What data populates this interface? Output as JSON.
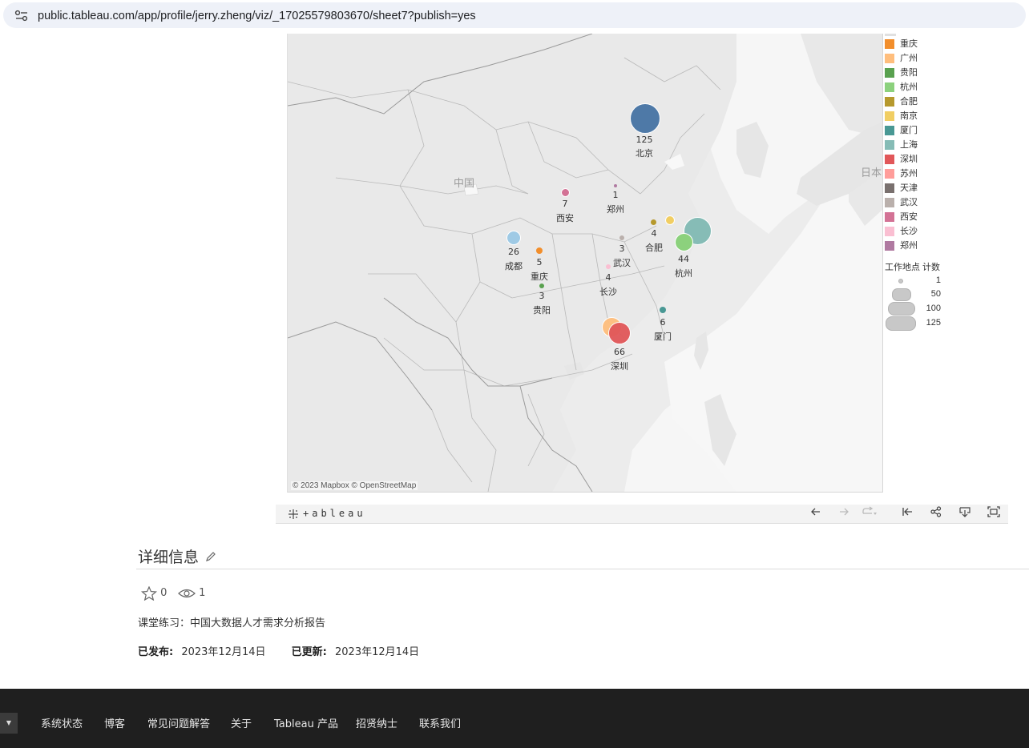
{
  "browser": {
    "url": "public.tableau.com/app/profile/jerry.zheng/viz/_17025579803670/sheet7?publish=yes"
  },
  "map": {
    "attribution": "© 2023 Mapbox  © OpenStreetMap",
    "country_labels": [
      "中国",
      "日本"
    ],
    "cities": [
      {
        "name": "北京",
        "count": "125",
        "color": "#4e79a7"
      },
      {
        "name": "郑州",
        "count": "1",
        "color": "#b07aa1"
      },
      {
        "name": "西安",
        "count": "7",
        "color": "#d37295"
      },
      {
        "name": "合肥",
        "count": "4",
        "color": "#b6992d"
      },
      {
        "name": "成都",
        "count": "26",
        "color": "#9fcae5"
      },
      {
        "name": "武汉",
        "count": "3",
        "color": "#bab0ac"
      },
      {
        "name": "杭州",
        "count": "44",
        "color": "#8cd17d"
      },
      {
        "name": "重庆",
        "count": "5",
        "color": "#f28e2b"
      },
      {
        "name": "长沙",
        "count": "4",
        "color": "#fabfd2"
      },
      {
        "name": "贵阳",
        "count": "3",
        "color": "#59a14f"
      },
      {
        "name": "厦门",
        "count": "6",
        "color": "#499894"
      },
      {
        "name": "深圳",
        "count": "66",
        "color": "#e15759"
      }
    ],
    "unlabeled_markers": [
      {
        "name": "上海",
        "color": "#86bcb6"
      },
      {
        "name": "广州",
        "color": "#ffbe7d"
      },
      {
        "name": "南京",
        "color": "#f1ce63"
      }
    ]
  },
  "legend": {
    "color_items": [
      {
        "label": "重庆",
        "color": "#f28e2b"
      },
      {
        "label": "广州",
        "color": "#ffbe7d"
      },
      {
        "label": "贵阳",
        "color": "#59a14f"
      },
      {
        "label": "杭州",
        "color": "#8cd17d"
      },
      {
        "label": "合肥",
        "color": "#b6992d"
      },
      {
        "label": "南京",
        "color": "#f1ce63"
      },
      {
        "label": "厦门",
        "color": "#499894"
      },
      {
        "label": "上海",
        "color": "#86bcb6"
      },
      {
        "label": "深圳",
        "color": "#e15759"
      },
      {
        "label": "苏州",
        "color": "#ff9d9a"
      },
      {
        "label": "天津",
        "color": "#79706e"
      },
      {
        "label": "武汉",
        "color": "#bab0ac"
      },
      {
        "label": "西安",
        "color": "#d37295"
      },
      {
        "label": "长沙",
        "color": "#fabfd2"
      },
      {
        "label": "郑州",
        "color": "#b07aa1"
      }
    ],
    "size_title": "工作地点 计数",
    "size_items": [
      "1",
      "50",
      "100",
      "125"
    ]
  },
  "toolbar": {
    "logo": "+ableau",
    "buttons": [
      "undo-icon",
      "redo-icon",
      "revert-icon",
      "reset-icon",
      "share-icon",
      "download-icon",
      "fullscreen-icon"
    ]
  },
  "details": {
    "title": "详细信息",
    "favorites": "0",
    "views": "1",
    "description": "课堂练习：中国大数据人才需求分析报告",
    "published_label": "已发布:",
    "published_date": "2023年12月14日",
    "updated_label": "已更新:",
    "updated_date": "2023年12月14日"
  },
  "footer": {
    "links": [
      "系统状态",
      "博客",
      "常见问题解答",
      "关于",
      "Tableau 产品",
      "招贤纳士",
      "联系我们"
    ]
  }
}
